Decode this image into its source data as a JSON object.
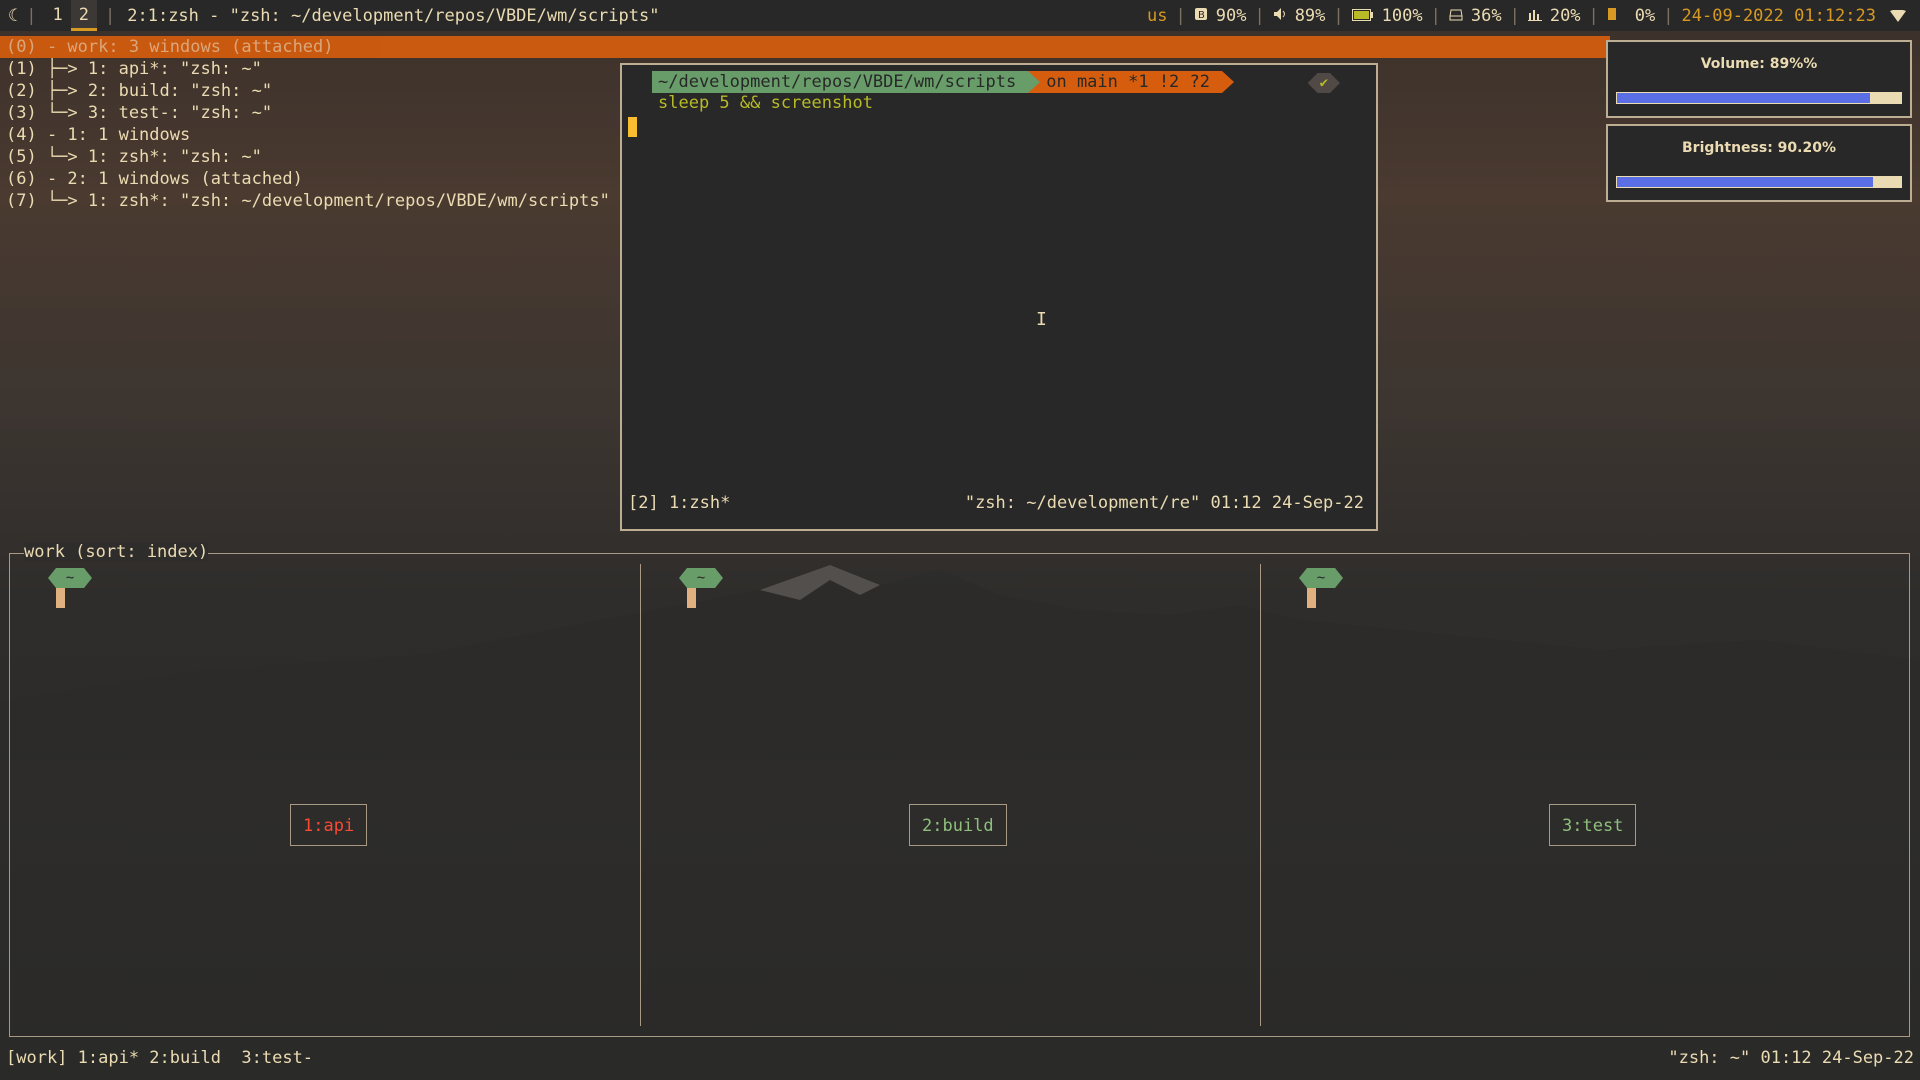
{
  "topbar": {
    "logo": "☾",
    "workspaces": [
      {
        "label": "1",
        "active": false
      },
      {
        "label": "2",
        "active": true
      }
    ],
    "window_title": "2:1:zsh - \"zsh: ~/development/repos/VBDE/wm/scripts\"",
    "keyboard": "us",
    "brightness": "90%",
    "volume": "89%",
    "battery": "100%",
    "disk": "36%",
    "cpu": "20%",
    "memory": "0%",
    "datetime": "24-09-2022 01:12:23",
    "icons": {
      "brightness": "brightness-icon",
      "volume": "speaker-icon",
      "battery": "battery-icon",
      "disk": "disk-icon",
      "cpu": "cpu-chart-icon",
      "memory": "memory-icon",
      "wifi": "wifi-icon"
    }
  },
  "tree": [
    {
      "text": "(0) - work: 3 windows (attached)",
      "selected": true
    },
    {
      "text": "(1) ├─> 1: api*: \"zsh: ~\"",
      "selected": false
    },
    {
      "text": "(2) ├─> 2: build: \"zsh: ~\"",
      "selected": false
    },
    {
      "text": "(3) └─> 3: test-: \"zsh: ~\"",
      "selected": false
    },
    {
      "text": "(4) - 1: 1 windows",
      "selected": false
    },
    {
      "text": "(5) └─> 1: zsh*: \"zsh: ~\"",
      "selected": false
    },
    {
      "text": "(6) - 2: 1 windows (attached)",
      "selected": false
    },
    {
      "text": "(7) └─> 1: zsh*: \"zsh: ~/development/repos/VBDE/wm/scripts\"",
      "selected": false
    }
  ],
  "terminal": {
    "path": "~/development/repos/VBDE/wm/scripts",
    "git": "on main *1 !2 ?2",
    "check": "✔",
    "command": "sleep 5 && screenshot",
    "status_left": "[2] 1:zsh*",
    "status_right": "\"zsh: ~/development/re\" 01:12 24-Sep-22"
  },
  "osd": {
    "volume_label": "Volume: 89%%",
    "volume_level": 0.89,
    "brightness_label": "Brightness: 90.20%",
    "brightness_level": 0.902
  },
  "work": {
    "title": "work (sort: index)",
    "prompt_symbol": "~",
    "windows": [
      {
        "label": "1:api",
        "color": "#fb4934"
      },
      {
        "label": "2:build",
        "color": "#8ec07c"
      },
      {
        "label": "3:test",
        "color": "#8ec07c"
      }
    ]
  },
  "bottom": {
    "left": "[work] 1:api* 2:build  3:test-",
    "right": "\"zsh: ~\" 01:12 24-Sep-22"
  }
}
